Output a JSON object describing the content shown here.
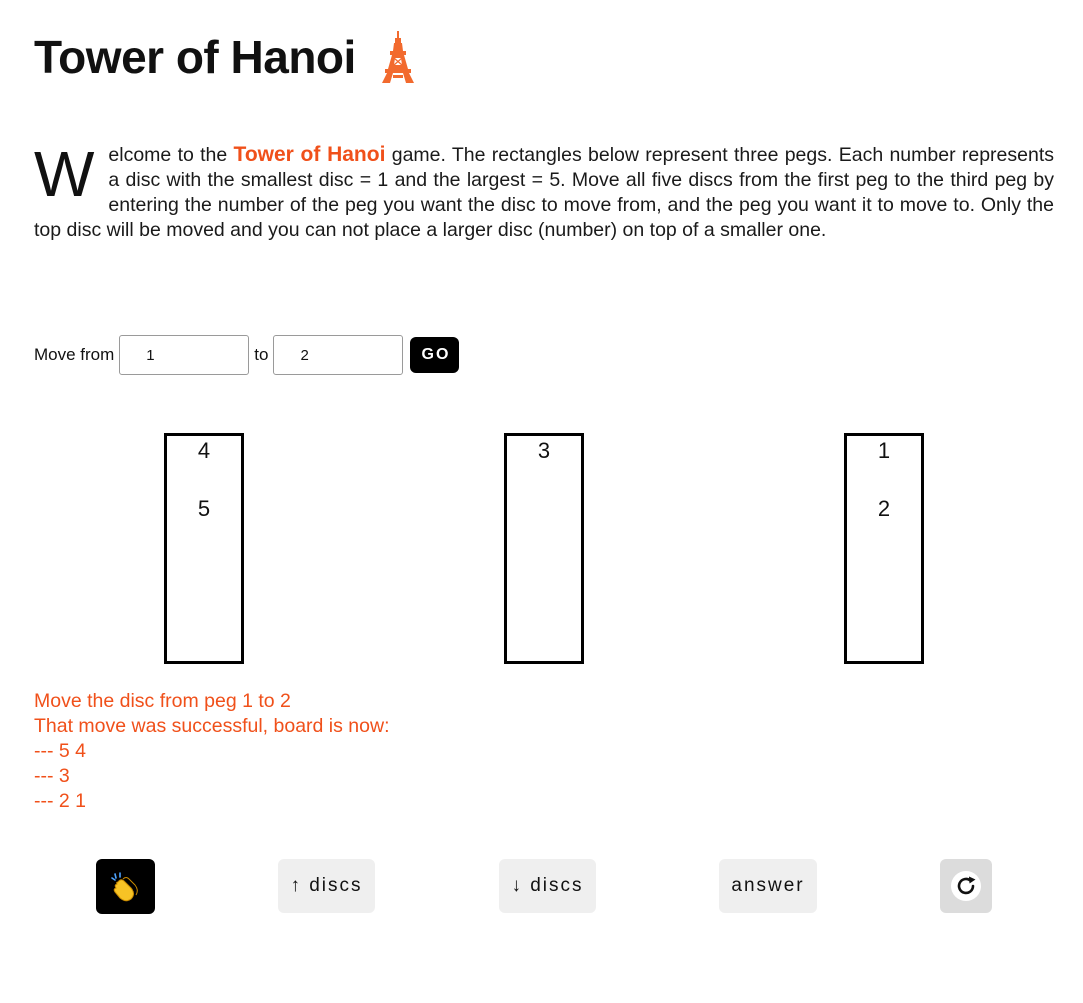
{
  "header": {
    "title": "Tower of Hanoi",
    "icon": "tokyo-tower-icon"
  },
  "intro": {
    "dropcap": "W",
    "pre": "elcome to the ",
    "highlight": "Tower of Hanoi",
    "post": " game. The rectangles below represent three pegs. Each number represents a disc with the smallest disc = 1 and the largest = 5. Move all five discs from the first peg to the third peg by entering the number of the peg you want the disc to move from, and the peg you want it to move to. Only the top disc will be moved and you can not place a larger disc (number) on top of a smaller one."
  },
  "move_form": {
    "from_label": "Move from",
    "from_value": "1",
    "to_label": "to",
    "to_value": "2",
    "go_label": "GO"
  },
  "pegs": [
    {
      "discs": [
        "4",
        "5"
      ]
    },
    {
      "discs": [
        "3"
      ]
    },
    {
      "discs": [
        "1",
        "2"
      ]
    }
  ],
  "log": [
    "Move the disc from peg 1 to 2",
    "That move was successful, board is now:",
    "--- 5 4",
    "--- 3",
    "--- 2 1"
  ],
  "buttons": {
    "clap_icon": "clapping-hands-icon",
    "more_discs": "↑ discs",
    "fewer_discs": "↓ discs",
    "answer": "answer",
    "reset_icon": "reload-icon"
  },
  "colors": {
    "accent": "#f0501a",
    "button_bg": "#efefef",
    "go_bg": "#000000"
  }
}
